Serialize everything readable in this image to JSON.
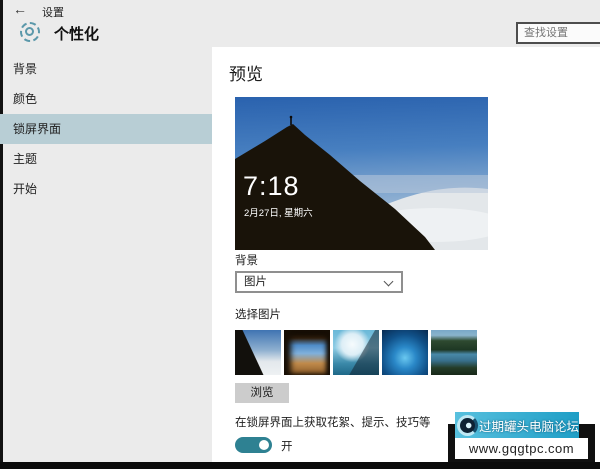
{
  "window": {
    "back_arrow": "←",
    "title": "设置"
  },
  "header": {
    "app_title": "个性化",
    "search_placeholder": "查找设置"
  },
  "sidebar": {
    "items": [
      {
        "label": "背景",
        "selected": false
      },
      {
        "label": "颜色",
        "selected": false
      },
      {
        "label": "锁屏界面",
        "selected": true
      },
      {
        "label": "主题",
        "selected": false
      },
      {
        "label": "开始",
        "selected": false
      }
    ]
  },
  "content": {
    "preview_heading": "预览",
    "lockscreen_preview": {
      "time": "7:18",
      "date": "2月27日, 星期六"
    },
    "background_section": {
      "label": "背景",
      "selected_option": "图片"
    },
    "picture_section": {
      "label": "选择图片",
      "thumbnails": [
        "hero-mountain",
        "beach-cave",
        "cloud-window",
        "ice-cave",
        "mountain-lake"
      ],
      "browse_label": "浏览"
    },
    "tips_section": {
      "label": "在锁屏界面上获取花絮、提示、技巧等",
      "toggle_state": "开",
      "toggle_on": true
    }
  },
  "watermark": {
    "forum_name": "过期罐头电脑论坛",
    "url": "www.gqgtpc.com"
  },
  "colors": {
    "accent_teal": "#2e8192",
    "selected_item_bg": "#b8ced5",
    "banner_teal": "#2aa6c9",
    "sidebar_bg": "#ebebeb",
    "main_bg": "#ffffff"
  }
}
